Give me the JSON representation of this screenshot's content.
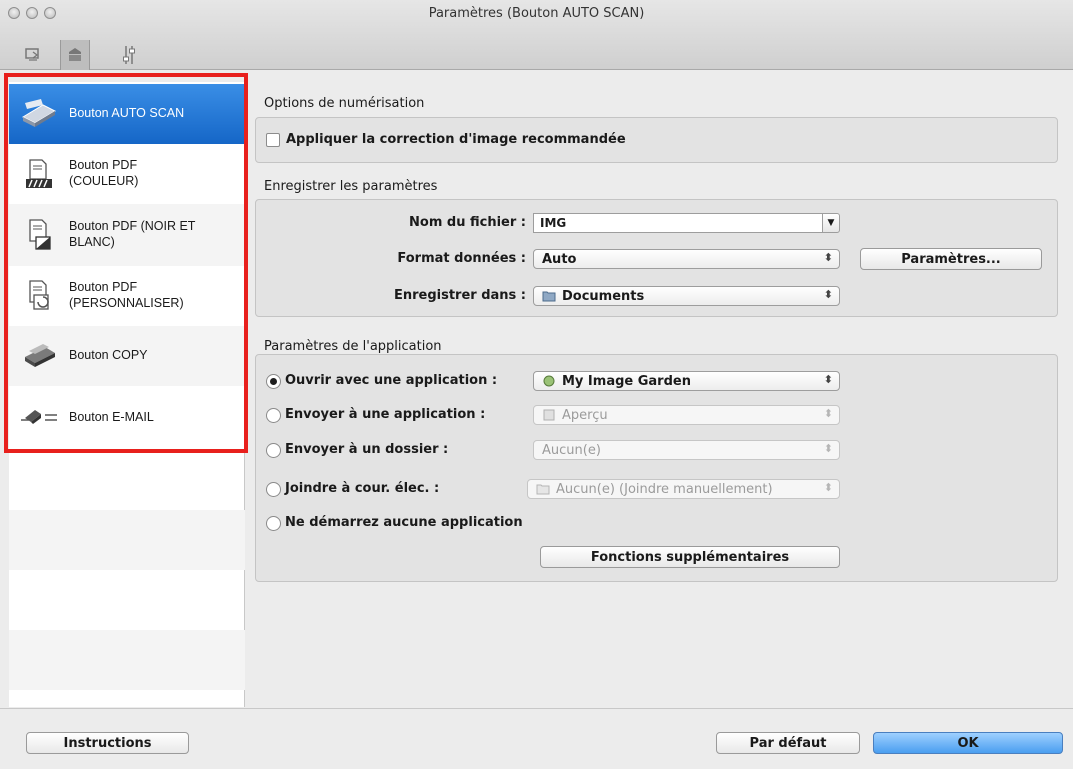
{
  "window": {
    "title": "Paramètres (Bouton AUTO SCAN)"
  },
  "toolbar": {
    "tabs": [
      "scan-from-computer-icon",
      "scan-from-panel-icon",
      "general-settings-icon"
    ]
  },
  "sidebar": {
    "items": [
      {
        "label": "Bouton AUTO SCAN",
        "icon": "scanner-icon",
        "selected": true
      },
      {
        "label": "Bouton PDF\n(COULEUR)",
        "icon": "pdf-color-icon"
      },
      {
        "label": "Bouton PDF (NOIR ET\nBLANC)",
        "icon": "pdf-bw-icon"
      },
      {
        "label": "Bouton PDF\n(PERSONNALISER)",
        "icon": "pdf-custom-icon"
      },
      {
        "label": "Bouton COPY",
        "icon": "copy-icon"
      },
      {
        "label": "Bouton E-MAIL",
        "icon": "email-icon"
      }
    ]
  },
  "scan_options": {
    "title": "Options de numérisation",
    "apply_correction_label": "Appliquer la correction d'image recommandée",
    "apply_correction_checked": false
  },
  "save_settings": {
    "title": "Enregistrer les paramètres",
    "filename_label": "Nom du fichier :",
    "filename_value": "IMG",
    "format_label": "Format données :",
    "format_value": "Auto",
    "settings_button": "Paramètres...",
    "save_in_label": "Enregistrer dans :",
    "save_in_value": "Documents"
  },
  "app_settings": {
    "title": "Paramètres de l'application",
    "options": [
      {
        "label": "Ouvrir avec une application :",
        "value": "My Image Garden",
        "selected": true,
        "enabled": true
      },
      {
        "label": "Envoyer à une application :",
        "value": "Aperçu",
        "selected": false,
        "enabled": false
      },
      {
        "label": "Envoyer à un dossier :",
        "value": "Aucun(e)",
        "selected": false,
        "enabled": false
      },
      {
        "label": "Joindre à cour. élec. :",
        "value": "Aucun(e) (Joindre manuellement)",
        "selected": false,
        "enabled": false
      },
      {
        "label": "Ne démarrez aucune application",
        "selected": false
      }
    ],
    "more_functions_button": "Fonctions supplémentaires"
  },
  "footer": {
    "instructions_button": "Instructions",
    "defaults_button": "Par défaut",
    "ok_button": "OK"
  },
  "colors": {
    "selection": "#1a6fd0",
    "highlight_border": "#e8201d",
    "default_button": "#4a9ef0"
  }
}
